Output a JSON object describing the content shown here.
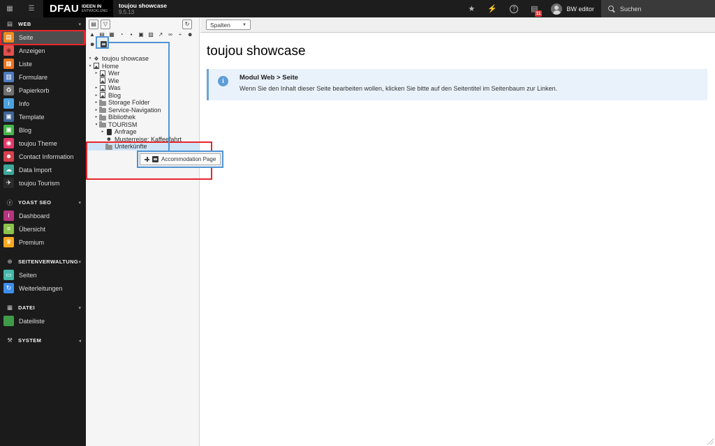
{
  "topbar": {
    "logo": {
      "main": "DFAU",
      "sub1": "IDEEN IN",
      "sub2": "ENTWICKLUNG"
    },
    "site_title": "toujou showcase",
    "version": "9.5.13",
    "user": "BW editor",
    "search_label": "Suchen",
    "sysinfo_badge": "11"
  },
  "sidebar": {
    "sections": [
      {
        "label": "WEB",
        "icon": "document-icon",
        "chevron": "down",
        "items": [
          {
            "label": "Seite",
            "icon": "page-icon",
            "color": "#ef8b1f",
            "active": true
          },
          {
            "label": "Anzeigen",
            "icon": "eye-icon",
            "color": "#e4504d"
          },
          {
            "label": "Liste",
            "icon": "list-icon",
            "color": "#e8731e"
          },
          {
            "label": "Formulare",
            "icon": "form-icon",
            "color": "#4f7cbf"
          },
          {
            "label": "Papierkorb",
            "icon": "trash-icon",
            "color": "#707070"
          },
          {
            "label": "Info",
            "icon": "info-icon",
            "color": "#4aa2e0"
          },
          {
            "label": "Template",
            "icon": "template-icon",
            "color": "#3f6596"
          },
          {
            "label": "Blog",
            "icon": "blog-icon",
            "color": "#46b449"
          },
          {
            "label": "toujou Theme",
            "icon": "fingerprint-icon",
            "color": "#e0396b"
          },
          {
            "label": "Contact Information",
            "icon": "contacts-icon",
            "color": "#d6404d"
          },
          {
            "label": "Data Import",
            "icon": "cloud-upload-icon",
            "color": "#3fa69b"
          },
          {
            "label": "toujou Tourism",
            "icon": "plane-icon",
            "color": "#2a2a2a"
          }
        ]
      },
      {
        "label": "YOAST SEO",
        "icon": "yoast-icon",
        "chevron": "down",
        "items": [
          {
            "label": "Dashboard",
            "icon": "info-icon",
            "color": "#b5357f"
          },
          {
            "label": "Übersicht",
            "icon": "list-lines-icon",
            "color": "#8bc34a"
          },
          {
            "label": "Premium",
            "icon": "trophy-icon",
            "color": "#f6a821"
          }
        ]
      },
      {
        "label": "SEITENVERWALTUNG",
        "icon": "globe-icon",
        "chevron": "down",
        "items": [
          {
            "label": "Seiten",
            "icon": "monitor-icon",
            "color": "#45b8a9"
          },
          {
            "label": "Weiterleitungen",
            "icon": "redirect-icon",
            "color": "#3e8ef0"
          }
        ]
      },
      {
        "label": "DATEI",
        "icon": "image-icon",
        "chevron": "down",
        "items": [
          {
            "label": "Dateiliste",
            "icon": "filelist-icon",
            "color": "#3f9b47"
          }
        ]
      },
      {
        "label": "SYSTEM",
        "icon": "wrench-icon",
        "chevron": "left",
        "items": []
      }
    ]
  },
  "tree_panel": {
    "toolbar": {
      "drag_types": [
        "mountain-page-icon",
        "blank-page-icon",
        "grid-icon",
        "clock-icon",
        "shortcut-icon",
        "mountpoint-icon",
        "folder-icon",
        "external-link-icon",
        "link-icon",
        "divider-icon",
        "usergroup-icon"
      ],
      "row3_user": "user-icon",
      "row3_accommodation": "accommodation-page-icon"
    },
    "nodes": [
      {
        "label": "toujou showcase",
        "depth": 0,
        "arrow": "open",
        "icon": "site-root"
      },
      {
        "label": "Home",
        "depth": 0,
        "arrow": "open",
        "icon": "page"
      },
      {
        "label": "Wer",
        "depth": 1,
        "arrow": "closed",
        "icon": "page"
      },
      {
        "label": "Wie",
        "depth": 1,
        "arrow": "none",
        "icon": "page"
      },
      {
        "label": "Was",
        "depth": 1,
        "arrow": "closed",
        "icon": "page"
      },
      {
        "label": "Blog",
        "depth": 1,
        "arrow": "closed",
        "icon": "page"
      },
      {
        "label": "Storage Folder",
        "depth": 1,
        "arrow": "closed",
        "icon": "folder"
      },
      {
        "label": "Service-Navigation",
        "depth": 1,
        "arrow": "closed",
        "icon": "folder"
      },
      {
        "label": "Bibliothek",
        "depth": 1,
        "arrow": "closed",
        "icon": "folder"
      },
      {
        "label": "TOURISM",
        "depth": 1,
        "arrow": "open",
        "icon": "folder"
      },
      {
        "label": "Anfrage",
        "depth": 2,
        "arrow": "closed",
        "icon": "doc"
      },
      {
        "label": "Musterreise: Kaffeefahrt",
        "depth": 2,
        "arrow": "none",
        "icon": "users",
        "underline": true
      },
      {
        "label": "Unterkünfte",
        "depth": 2,
        "arrow": "none",
        "icon": "folder",
        "highlight": true
      }
    ],
    "drag_tooltip_label": "Accommodation Page"
  },
  "docheader": {
    "columns_select": "Spalten"
  },
  "content": {
    "page_title": "toujou showcase",
    "callout": {
      "title": "Modul Web > Seite",
      "text": "Wenn Sie den Inhalt dieser Seite bearbeiten wollen, klicken Sie bitte auf den Seitentitel im Seitenbaum zur Linken."
    }
  },
  "annotations": {
    "highlight_red": "#e8262d",
    "highlight_blue": "#4f94d6"
  }
}
